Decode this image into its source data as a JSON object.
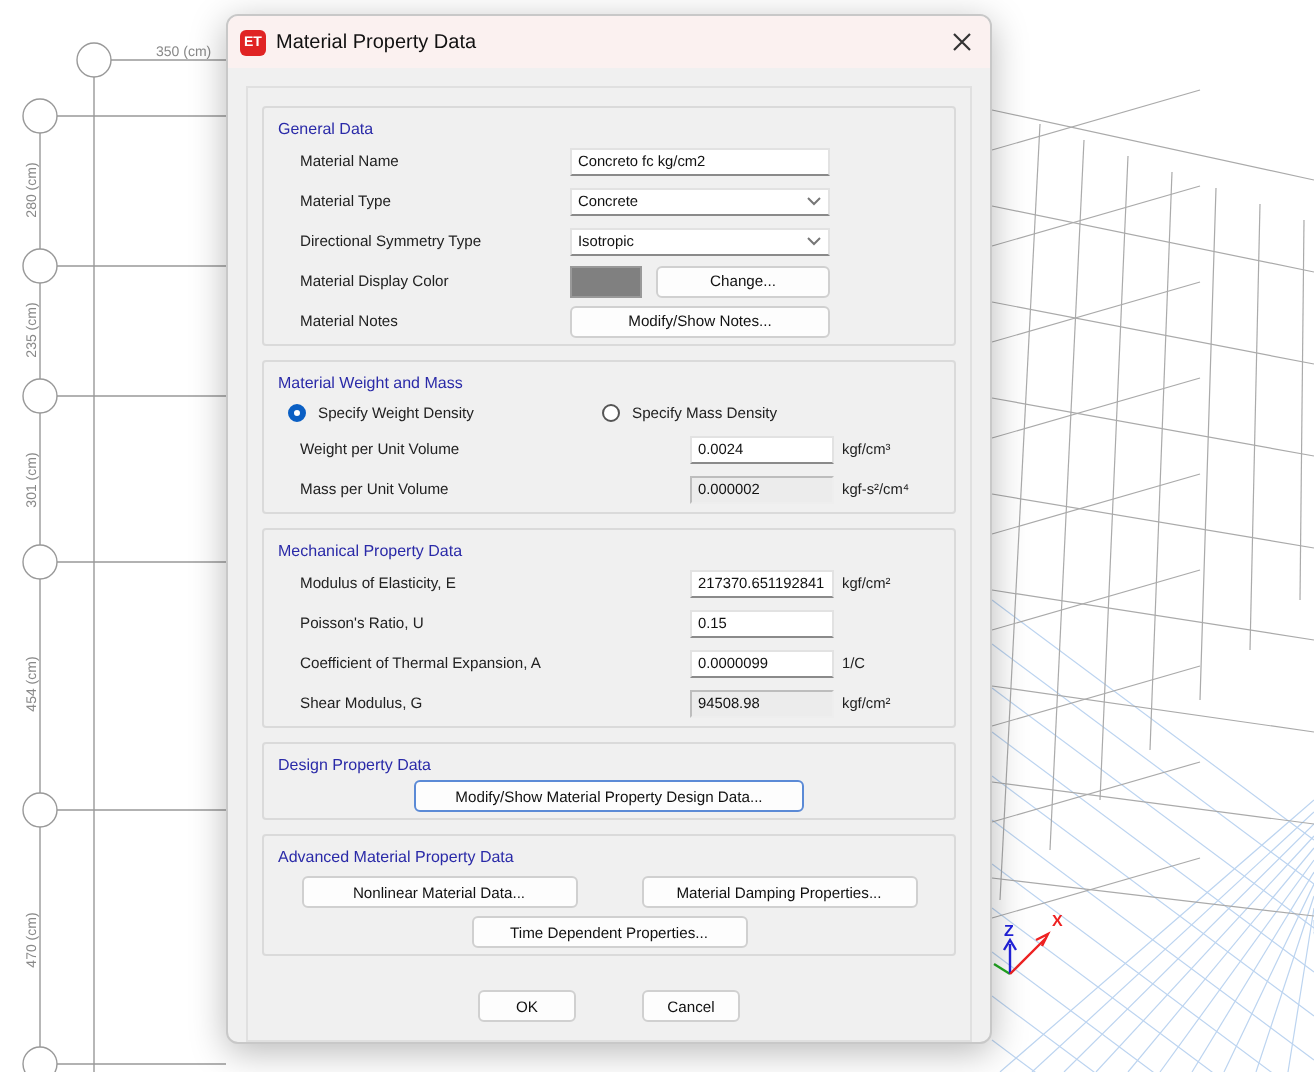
{
  "background": {
    "plan_dimensions": [
      {
        "label": "350 (cm)",
        "kind": "horizontal"
      },
      {
        "label": "280 (cm)",
        "kind": "vertical"
      },
      {
        "label": "235 (cm)",
        "kind": "vertical"
      },
      {
        "label": "301 (cm)",
        "kind": "vertical"
      },
      {
        "label": "454 (cm)",
        "kind": "vertical"
      },
      {
        "label": "470 (cm)",
        "kind": "vertical"
      }
    ],
    "axes": [
      "Z",
      "X"
    ]
  },
  "window": {
    "icon_text": "ET",
    "title": "Material Property Data"
  },
  "general_data": {
    "legend": "General Data",
    "rows": [
      {
        "kind": "text",
        "label": "Material Name",
        "value": "Concreto fc kg/cm2"
      },
      {
        "kind": "dropdown",
        "label": "Material Type",
        "value": "Concrete"
      },
      {
        "kind": "dropdown",
        "label": "Directional Symmetry Type",
        "value": "Isotropic"
      },
      {
        "kind": "color",
        "label": "Material Display Color",
        "color": "#808080",
        "button": "Change..."
      },
      {
        "kind": "button",
        "label": "Material Notes",
        "button": "Modify/Show Notes..."
      }
    ]
  },
  "weight_and_mass": {
    "legend": "Material Weight and Mass",
    "options": [
      {
        "label": "Specify Weight Density",
        "selected": true
      },
      {
        "label": "Specify Mass Density",
        "selected": false
      }
    ],
    "rows": [
      {
        "kind": "input",
        "label": "Weight per Unit Volume",
        "value": "0.0024",
        "unit": "kgf/cm³"
      },
      {
        "kind": "readonly",
        "label": "Mass per Unit Volume",
        "value": "0.000002",
        "unit": "kgf-s²/cm⁴"
      }
    ]
  },
  "mechanical": {
    "legend": "Mechanical Property Data",
    "rows": [
      {
        "kind": "input",
        "label": "Modulus of Elasticity,  E",
        "value": "217370.651192841",
        "unit": "kgf/cm²"
      },
      {
        "kind": "input",
        "label": "Poisson's Ratio,  U",
        "value": "0.15"
      },
      {
        "kind": "input",
        "label": "Coefficient of Thermal Expansion,  A",
        "value": "0.0000099",
        "unit": "1/C"
      },
      {
        "kind": "readonly",
        "label": "Shear Modulus,  G",
        "value": "94508.98",
        "unit": "kgf/cm²"
      }
    ]
  },
  "design": {
    "legend": "Design Property Data",
    "button": "Modify/Show Material Property Design Data..."
  },
  "advanced": {
    "legend": "Advanced Material Property Data",
    "buttons": [
      "Nonlinear Material Data...",
      "Material Damping Properties...",
      "Time Dependent Properties..."
    ]
  },
  "footer_buttons": [
    "OK",
    "Cancel"
  ]
}
